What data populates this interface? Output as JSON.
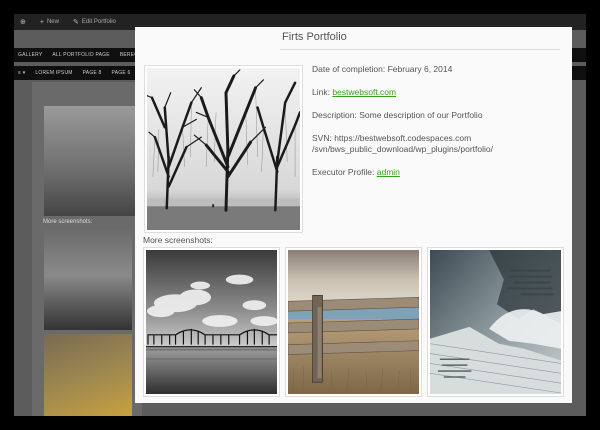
{
  "background": {
    "adminbar": {
      "new_label": "New",
      "edit_label": "Edit Portfolio"
    },
    "nav1": [
      "GALLERY",
      "ALL PORTFOLIO PAGE",
      "BEREGISTER",
      "N"
    ],
    "nav2": [
      "LOREM IPSUM",
      "PAGE 8",
      "PAGE 6"
    ],
    "screenshots_label": "More screenshots:"
  },
  "portfolio": {
    "title": "Firts Portfolio",
    "date_text": "Date of completion: February 6, 2014",
    "link_prefix": "Link: ",
    "link_text": "bestwebsoft.com",
    "description_text": "Description: Some description of our Portfolio",
    "svn_line1": "SVN: https://bestwebsoft.codespaces.com",
    "svn_line2": "/svn/bws_public_download/wp_plugins/portfolio/",
    "executor_prefix": "Executor Profile: ",
    "executor_link": "admin",
    "screenshots_label": "More screenshots:"
  },
  "colors": {
    "link": "#3aa01e",
    "lightbox_bg": "#fafafa",
    "overlay": "#000000"
  },
  "icons": {
    "wp_logo": "wordpress-icon",
    "plus": "plus-icon",
    "edit": "edit-icon"
  }
}
